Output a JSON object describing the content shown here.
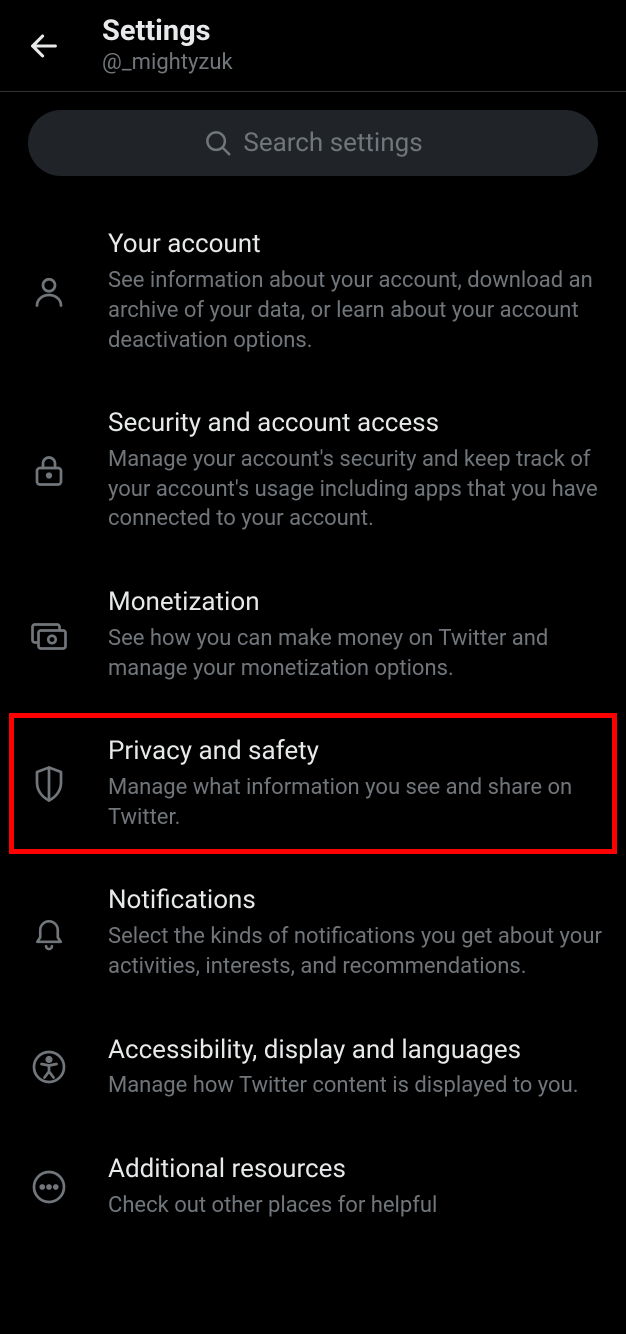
{
  "header": {
    "title": "Settings",
    "handle": "@_mightyzuk"
  },
  "search": {
    "placeholder": "Search settings"
  },
  "items": [
    {
      "title": "Your account",
      "desc": "See information about your account, download an archive of your data, or learn about your account deactivation options."
    },
    {
      "title": "Security and account access",
      "desc": "Manage your account's security and keep track of your account's usage including apps that you have connected to your account."
    },
    {
      "title": "Monetization",
      "desc": "See how you can make money on Twitter and manage your monetization options."
    },
    {
      "title": "Privacy and safety",
      "desc": "Manage what information you see and share on Twitter."
    },
    {
      "title": "Notifications",
      "desc": "Select the kinds of notifications you get about your activities, interests, and recommendations."
    },
    {
      "title": "Accessibility, display and languages",
      "desc": "Manage how Twitter content is displayed to you."
    },
    {
      "title": "Additional resources",
      "desc": "Check out other places for helpful"
    }
  ]
}
